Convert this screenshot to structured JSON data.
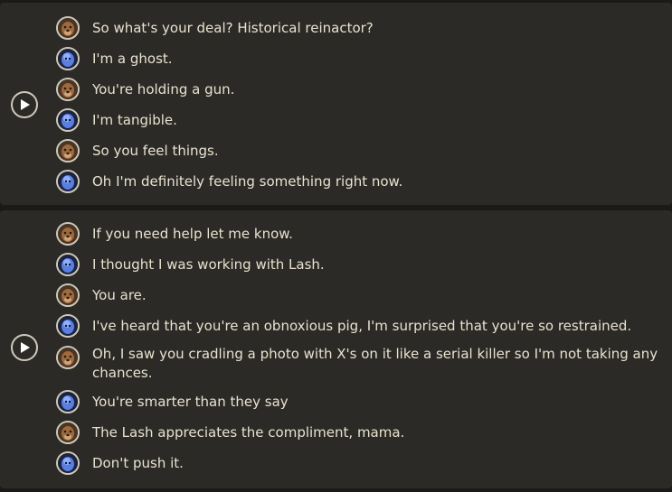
{
  "conversations": [
    {
      "lines": [
        {
          "speaker": "dog",
          "text": "So what's your deal?  Historical reinactor?"
        },
        {
          "speaker": "ghost",
          "text": "I'm a ghost."
        },
        {
          "speaker": "dog",
          "text": "You're holding a gun."
        },
        {
          "speaker": "ghost",
          "text": "I'm tangible."
        },
        {
          "speaker": "dog",
          "text": "So you feel things."
        },
        {
          "speaker": "ghost",
          "text": "Oh I'm definitely feeling something right now."
        }
      ]
    },
    {
      "lines": [
        {
          "speaker": "dog",
          "text": "If you need help let me know."
        },
        {
          "speaker": "ghost",
          "text": "I thought I was working with Lash."
        },
        {
          "speaker": "dog",
          "text": "You are."
        },
        {
          "speaker": "ghost",
          "text": "I've heard that you're an obnoxious pig, I'm surprised that you're so restrained."
        },
        {
          "speaker": "dog",
          "text": "Oh, I saw you cradling a photo with X's on it like a serial killer so I'm not taking any chances."
        },
        {
          "speaker": "ghost",
          "text": "You're smarter than they say"
        },
        {
          "speaker": "dog",
          "text": "The Lash appreciates the compliment, mama."
        },
        {
          "speaker": "ghost",
          "text": "Don't push it."
        }
      ]
    }
  ],
  "icons": {
    "play": "play-icon",
    "dog_portrait": "dog-portrait-icon",
    "ghost_portrait": "ghost-portrait-icon"
  },
  "colors": {
    "panel": "#2b2a26",
    "text": "#e9e2d0",
    "dog_portrait": "#8a5a32",
    "ghost_portrait": "#5b7fe0"
  }
}
